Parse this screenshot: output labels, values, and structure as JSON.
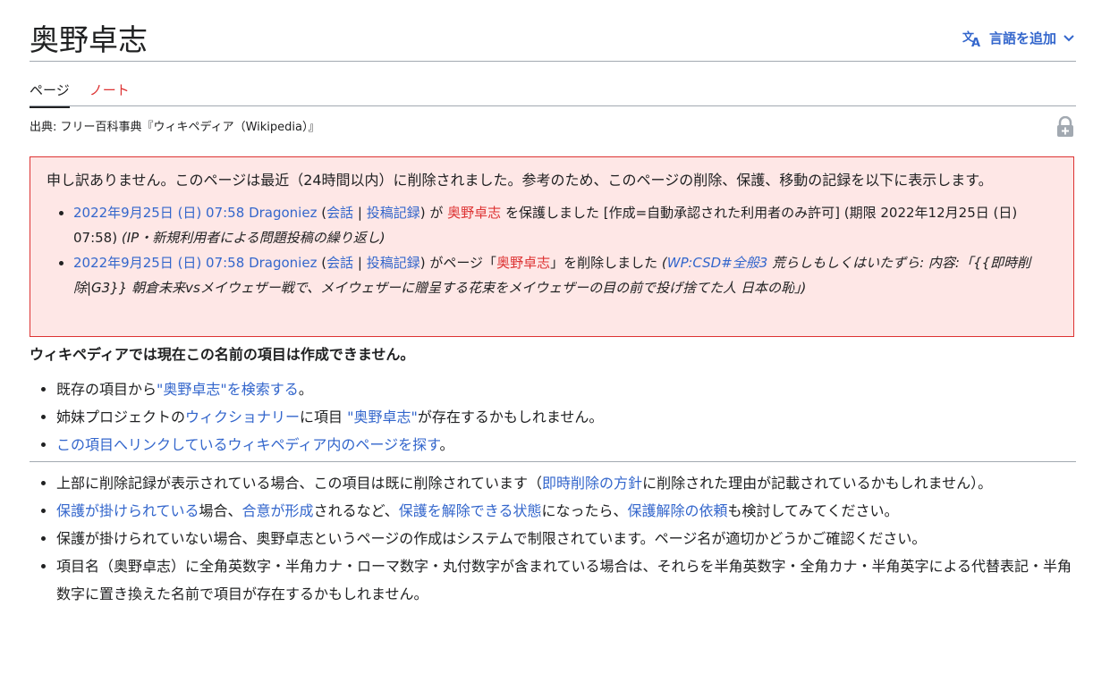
{
  "header": {
    "title": "奥野卓志",
    "add_languages_label": "言語を追加",
    "translate_icon": "translate-icon",
    "chevron_icon": "chevron-down-icon"
  },
  "tabs": [
    {
      "label": "ページ",
      "active": true
    },
    {
      "label": "ノート",
      "active": false
    }
  ],
  "source": "出典: フリー百科事典『ウィキペディア（Wikipedia）』",
  "notice": {
    "message": "申し訳ありません。このページは最近（24時間以内）に削除されました。参考のため、このページの削除、保護、移動の記録を以下に表示します。",
    "entries": [
      {
        "datetime": "2022年9月25日 (日) 07:58",
        "user": "Dragoniez",
        "talk": "会話",
        "sep": "|",
        "contribs": "投稿記録",
        "ga": "が",
        "page": "奥野卓志",
        "action": "を保護しました [作成=自動承認された利用者のみ許可] (期限 2022年12月25日 (日) 07:58)",
        "reason": "(IP・新規利用者による問題投稿の繰り返し)"
      },
      {
        "datetime": "2022年9月25日 (日) 07:58",
        "user": "Dragoniez",
        "talk": "会話",
        "sep": "|",
        "contribs": "投稿記録",
        "ga": "がページ「",
        "page": "奥野卓志",
        "action": "」を削除しました",
        "reason_prefix": "(",
        "reason_link": "WP:CSD#全般3",
        "reason_text": " 荒らしもしくはいたずら: 内容:「{{即時削除|G3}} 朝倉未来vsメイウェザー戦で、メイウェザーに贈呈する花束をメイウェザーの目の前で投げ捨てた人 日本の恥」)"
      }
    ]
  },
  "cannot_create": "ウィキペディアでは現在この名前の項目は作成できません。",
  "list1": {
    "item1_prefix": "既存の項目から",
    "item1_link": "\"奥野卓志\"を検索する",
    "item1_suffix": "。",
    "item2_prefix": "姉妹プロジェクトの",
    "item2_link1": "ウィクショナリー",
    "item2_mid": "に項目 ",
    "item2_link2": "\"奥野卓志\"",
    "item2_suffix": "が存在するかもしれません。",
    "item3_link": "この項目へリンクしているウィキペディア内のページを探す",
    "item3_suffix": "。"
  },
  "list2": {
    "item1_prefix": "上部に削除記録が表示されている場合、この項目は既に削除されています（",
    "item1_link": "即時削除の方針",
    "item1_suffix": "に削除された理由が記載されているかもしれません）。",
    "item2_link1": "保護が掛けられている",
    "item2_t1": "場合、",
    "item2_link2": "合意が形成",
    "item2_t2": "されるなど、",
    "item2_link3": "保護を解除できる状態",
    "item2_t3": "になったら、",
    "item2_link4": "保護解除の依頼",
    "item2_t4": "も検討してみてください。",
    "item3": "保護が掛けられていない場合、奥野卓志というページの作成はシステムで制限されています。ページ名が適切かどうかご確認ください。",
    "item4": "項目名（奥野卓志）に全角英数字・半角カナ・ローマ数字・丸付数字が含まれている場合は、それらを半角英数字・全角カナ・半角英字による代替表記・半角数字に置き換えた名前で項目が存在するかもしれません。"
  },
  "colors": {
    "link": "#3366cc",
    "redlink": "#d33",
    "notice_bg": "#fee7e6",
    "notice_border": "#d33"
  }
}
